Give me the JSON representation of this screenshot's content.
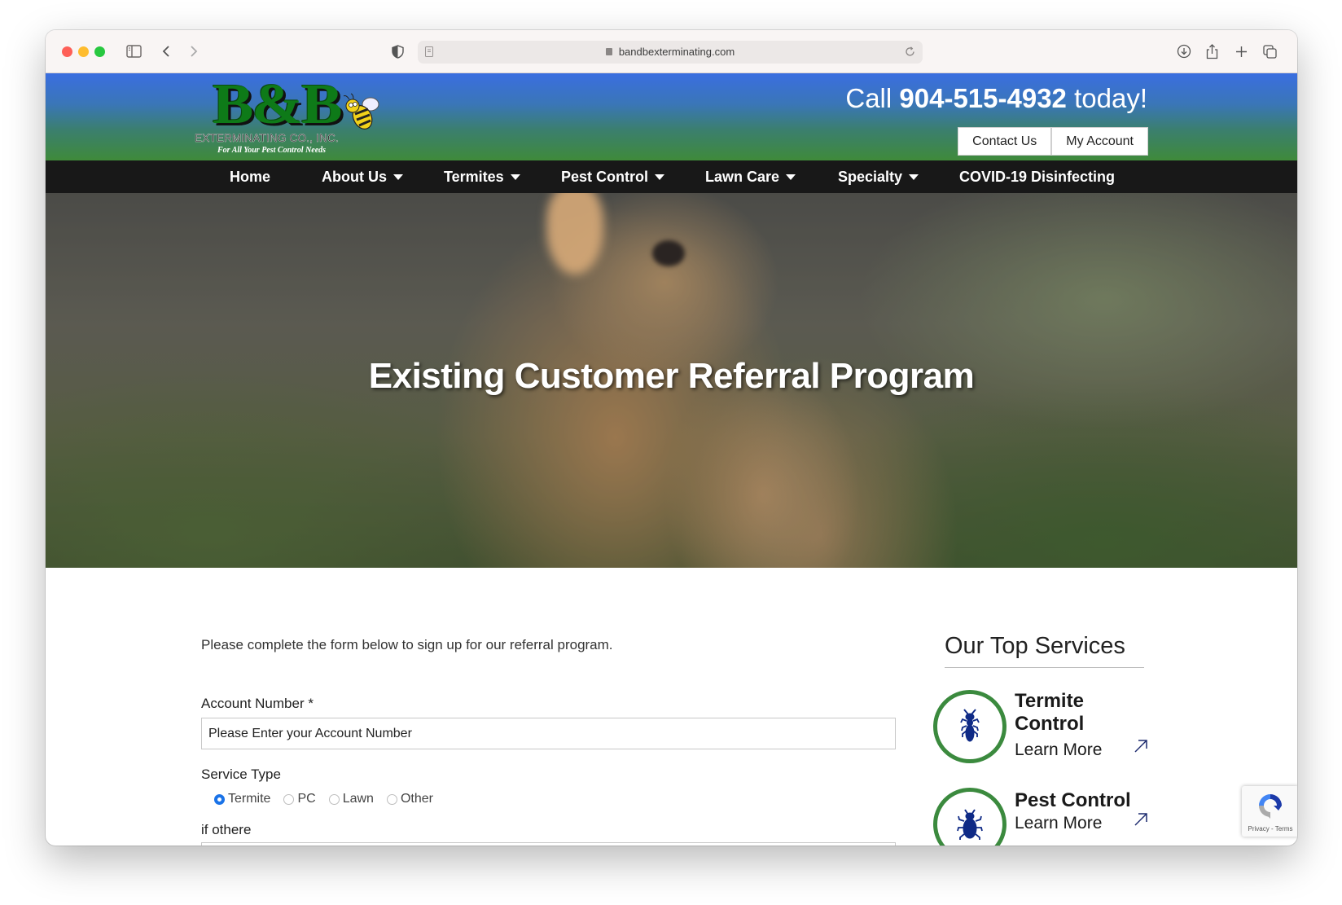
{
  "browser": {
    "url": "bandbexterminating.com",
    "icons": [
      "sidebar-icon",
      "back-icon",
      "forward-icon",
      "shield-icon",
      "page-icon",
      "reload-icon",
      "download-icon",
      "share-icon",
      "new-tab-icon",
      "tabs-overview-icon"
    ]
  },
  "header": {
    "logo_mark": "B&B",
    "logo_company": "EXTERMINATING CO., INC.",
    "logo_tagline": "For All Your Pest Control Needs",
    "call_prefix": "Call",
    "phone": "904-515-4932",
    "call_suffix": "today!",
    "buttons": [
      {
        "label": "Contact Us"
      },
      {
        "label": "My Account"
      }
    ]
  },
  "nav": {
    "items": [
      {
        "label": "Home",
        "dropdown": false
      },
      {
        "label": "About Us",
        "dropdown": true
      },
      {
        "label": "Termites",
        "dropdown": true
      },
      {
        "label": "Pest Control",
        "dropdown": true
      },
      {
        "label": "Lawn Care",
        "dropdown": true
      },
      {
        "label": "Specialty",
        "dropdown": true
      },
      {
        "label": "COVID-19 Disinfecting",
        "dropdown": false
      }
    ]
  },
  "hero": {
    "title": "Existing Customer Referral Program"
  },
  "form": {
    "intro": "Please complete the form below to sign up for our referral program.",
    "account_label": "Account Number *",
    "account_value": "Please Enter your Account Number",
    "service_label": "Service Type",
    "service_options": [
      {
        "label": "Termite",
        "checked": true
      },
      {
        "label": "PC",
        "checked": false
      },
      {
        "label": "Lawn",
        "checked": false
      },
      {
        "label": "Other",
        "checked": false
      }
    ],
    "other_label": "if othere"
  },
  "sidebar": {
    "title": "Our Top Services",
    "services": [
      {
        "name": "Termite Control",
        "link": "Learn More",
        "icon": "termite-icon"
      },
      {
        "name": "Pest Control",
        "link": "Learn More",
        "icon": "bug-icon"
      }
    ]
  },
  "recaptcha": {
    "text": "Privacy - Terms"
  },
  "colors": {
    "header_top": "#3a6ee0",
    "header_bottom": "#3f8a3a",
    "nav_bg": "#181818",
    "logo_green": "#0e7a18",
    "service_ring": "#3b8a3e",
    "service_icon": "#0f2a86",
    "radio_checked": "#1a73e8"
  }
}
